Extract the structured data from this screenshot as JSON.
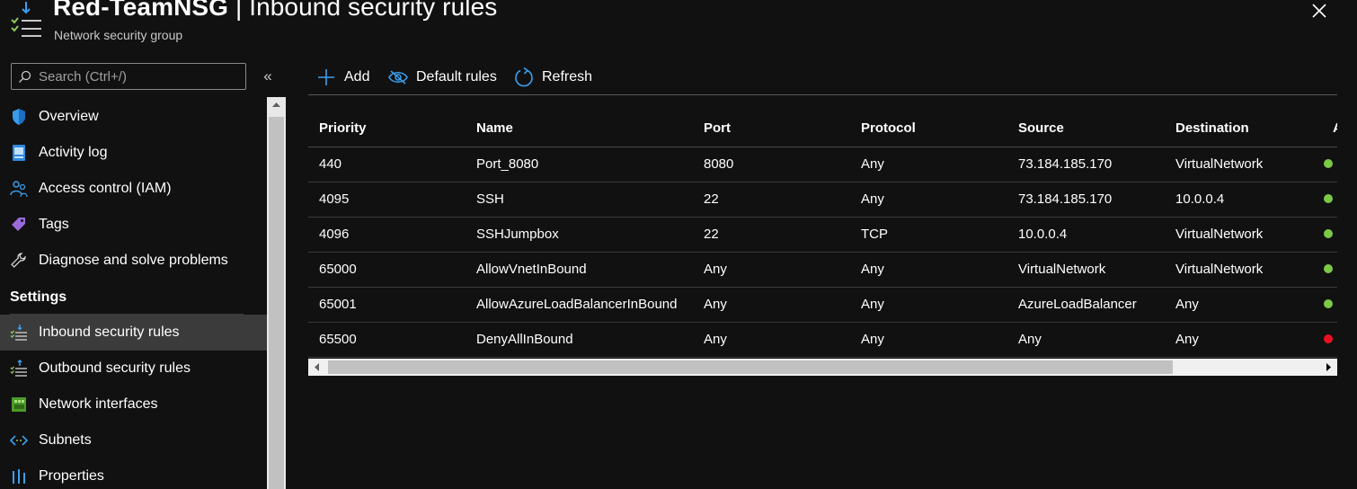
{
  "header": {
    "title_name": "Red-TeamNSG",
    "title_rest": " | Inbound security rules",
    "subtitle": "Network security group"
  },
  "sidebar": {
    "search_placeholder": "Search (Ctrl+/)",
    "collapse_label": "«",
    "items": [
      {
        "label": "Overview",
        "icon": "shield-icon"
      },
      {
        "label": "Activity log",
        "icon": "activity-log-icon"
      },
      {
        "label": "Access control (IAM)",
        "icon": "people-icon"
      },
      {
        "label": "Tags",
        "icon": "tag-icon"
      },
      {
        "label": "Diagnose and solve problems",
        "icon": "wrench-icon"
      }
    ],
    "section_settings": "Settings",
    "settings_items": [
      {
        "label": "Inbound security rules",
        "icon": "inbound-rules-icon",
        "active": true
      },
      {
        "label": "Outbound security rules",
        "icon": "outbound-rules-icon"
      },
      {
        "label": "Network interfaces",
        "icon": "network-interface-icon"
      },
      {
        "label": "Subnets",
        "icon": "subnet-icon"
      },
      {
        "label": "Properties",
        "icon": "properties-icon"
      }
    ]
  },
  "toolbar": {
    "add_label": "Add",
    "default_rules_label": "Default rules",
    "refresh_label": "Refresh"
  },
  "table": {
    "columns": [
      "Priority",
      "Name",
      "Port",
      "Protocol",
      "Source",
      "Destination",
      "A"
    ],
    "rows": [
      {
        "priority": "440",
        "name": "Port_8080",
        "port": "8080",
        "protocol": "Any",
        "source": "73.184.185.170",
        "destination": "VirtualNetwork",
        "action_color": "#7cc847"
      },
      {
        "priority": "4095",
        "name": "SSH",
        "port": "22",
        "protocol": "Any",
        "source": "73.184.185.170",
        "destination": "10.0.0.4",
        "action_color": "#7cc847"
      },
      {
        "priority": "4096",
        "name": "SSHJumpbox",
        "port": "22",
        "protocol": "TCP",
        "source": "10.0.0.4",
        "destination": "VirtualNetwork",
        "action_color": "#7cc847"
      },
      {
        "priority": "65000",
        "name": "AllowVnetInBound",
        "port": "Any",
        "protocol": "Any",
        "source": "VirtualNetwork",
        "destination": "VirtualNetwork",
        "action_color": "#7cc847"
      },
      {
        "priority": "65001",
        "name": "AllowAzureLoadBalancerInBound",
        "port": "Any",
        "protocol": "Any",
        "source": "AzureLoadBalancer",
        "destination": "Any",
        "action_color": "#7cc847"
      },
      {
        "priority": "65500",
        "name": "DenyAllInBound",
        "port": "Any",
        "protocol": "Any",
        "source": "Any",
        "destination": "Any",
        "action_color": "#e81123"
      }
    ]
  },
  "colors": {
    "accent": "#0078d4",
    "allow": "#7cc847",
    "deny": "#e81123"
  }
}
